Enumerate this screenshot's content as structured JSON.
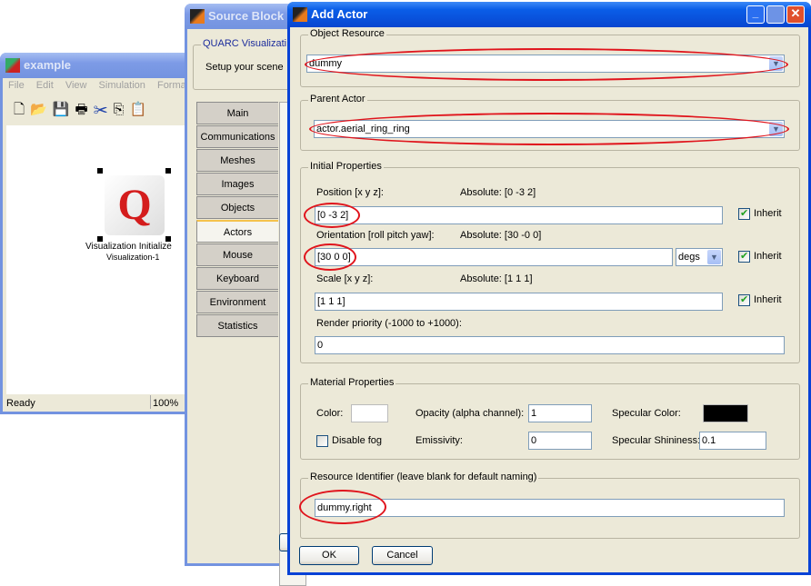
{
  "example_window": {
    "title": "example",
    "menu": [
      "File",
      "Edit",
      "View",
      "Simulation",
      "Format"
    ],
    "block": {
      "name": "Visualization Initialize",
      "subname": "Visualization-1"
    },
    "status": {
      "text": "Ready",
      "zoom": "100%"
    }
  },
  "source_block_window": {
    "title": "Source Block P",
    "group_label": "QUARC Visualizati",
    "description": "Setup your scene",
    "tabs": [
      "Main",
      "Communications",
      "Meshes",
      "Images",
      "Objects",
      "Actors",
      "Mouse",
      "Keyboard",
      "Environment",
      "Statistics"
    ],
    "selected_tab": "Actors"
  },
  "add_actor": {
    "title": "Add Actor",
    "object_resource": {
      "label": "Object Resource",
      "value": "dummy"
    },
    "parent_actor": {
      "label": "Parent Actor",
      "value": "actor.aerial_ring_ring"
    },
    "initial": {
      "label": "Initial Properties",
      "position": {
        "label": "Position [x y z]:",
        "absolute": "Absolute: [0 -3 2]",
        "value": "[0 -3 2]",
        "inherit": "Inherit",
        "inherit_checked": true
      },
      "orientation": {
        "label": "Orientation [roll pitch yaw]:",
        "absolute": "Absolute: [30 -0 0]",
        "value": "[30 0 0]",
        "unit": "degs",
        "inherit": "Inherit",
        "inherit_checked": true
      },
      "scale": {
        "label": "Scale [x y z]:",
        "absolute": "Absolute: [1 1 1]",
        "value": "[1 1 1]",
        "inherit": "Inherit",
        "inherit_checked": true
      },
      "priority": {
        "label": "Render priority (-1000 to +1000):",
        "value": "0"
      }
    },
    "material": {
      "label": "Material Properties",
      "color_label": "Color:",
      "color": "#ffffff",
      "opacity_label": "Opacity (alpha channel):",
      "opacity": "1",
      "specular_color_label": "Specular Color:",
      "specular_color": "#000000",
      "disable_fog": "Disable fog",
      "disable_fog_checked": false,
      "emissivity_label": "Emissivity:",
      "emissivity": "0",
      "shininess_label": "Specular Shininess:",
      "shininess": "0.1"
    },
    "resource_id": {
      "label": "Resource Identifier (leave blank for default naming)",
      "value": "dummy.right"
    },
    "ok": "OK",
    "cancel": "Cancel"
  }
}
